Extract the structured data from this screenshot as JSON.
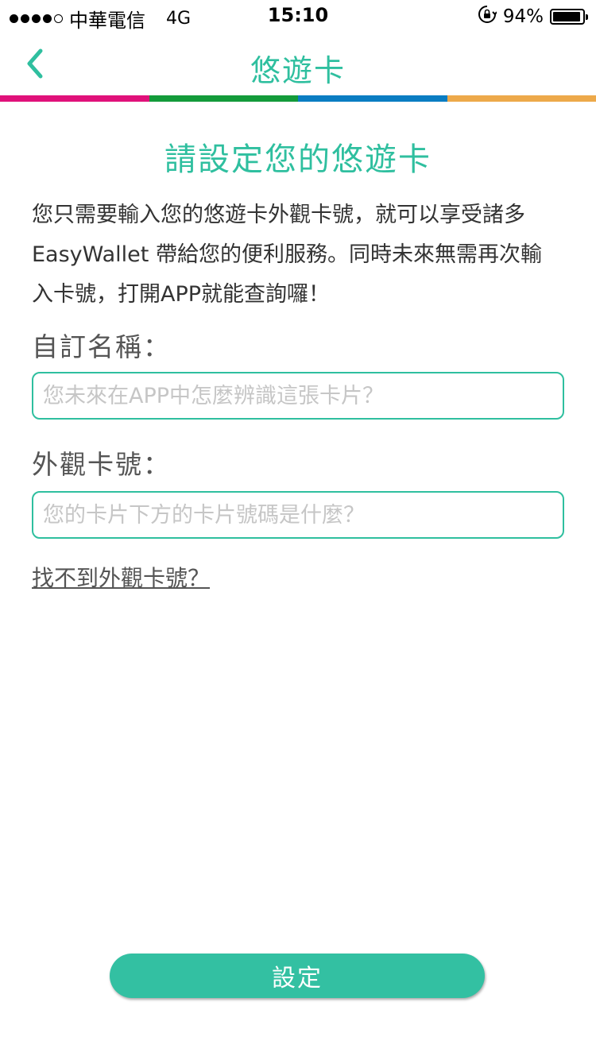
{
  "status_bar": {
    "carrier": "中華電信",
    "network": "4G",
    "time": "15:10",
    "battery": "94%",
    "battery_level": 0.94,
    "signal_bars_filled": 4,
    "signal_bars_total": 5
  },
  "nav": {
    "title": "悠遊卡",
    "back_icon": "chevron-left-icon"
  },
  "colors": {
    "accent": "#2fbf9f",
    "strip": [
      "#e0117a",
      "#139b3a",
      "#0a7dc2",
      "#eda94a"
    ]
  },
  "page": {
    "heading": "請設定您的悠遊卡",
    "description_lines": [
      "您只需要輸入您的悠遊卡外觀卡號，就可以享受諸多",
      "EasyWallet 帶給您的便利服務。同時未來無需再次輸",
      "入卡號，打開APP就能查詢囉！"
    ]
  },
  "form": {
    "name_label": "自訂名稱：",
    "name_placeholder": "您未來在APP中怎麼辨識這張卡片？",
    "name_value": "",
    "card_label": "外觀卡號：",
    "card_placeholder": "您的卡片下方的卡片號碼是什麼？",
    "card_value": "",
    "help_link": "找不到外觀卡號？",
    "submit_label": "設定"
  }
}
